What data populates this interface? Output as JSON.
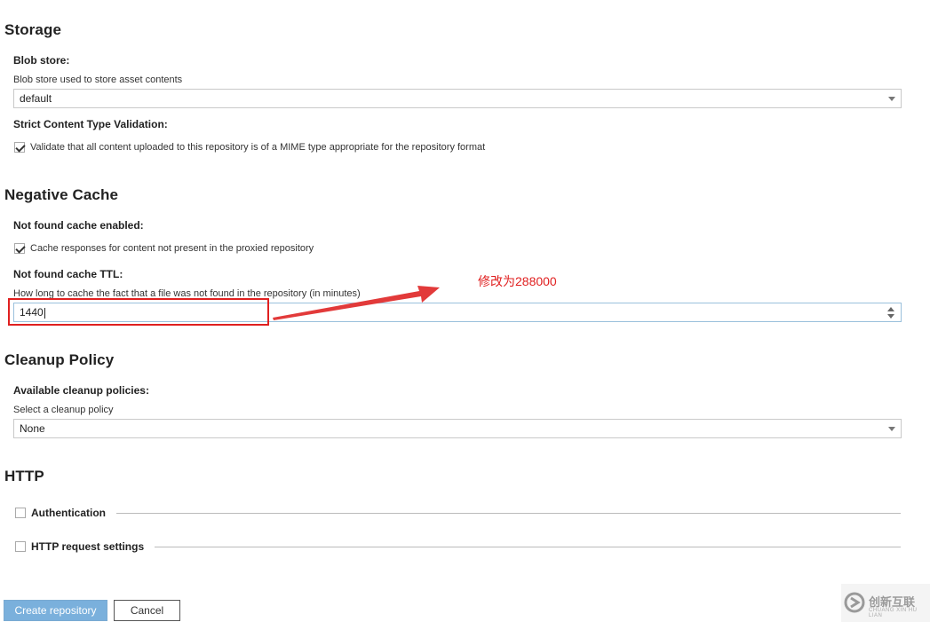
{
  "storage": {
    "title": "Storage",
    "blob_store": {
      "label": "Blob store:",
      "help": "Blob store used to store asset contents",
      "value": "default"
    },
    "strict_validation": {
      "label": "Strict Content Type Validation:",
      "checkbox_label": "Validate that all content uploaded to this repository is of a MIME type appropriate for the repository format",
      "checked": true
    }
  },
  "negative_cache": {
    "title": "Negative Cache",
    "enabled": {
      "label": "Not found cache enabled:",
      "checkbox_label": "Cache responses for content not present in the proxied repository",
      "checked": true
    },
    "ttl": {
      "label": "Not found cache TTL:",
      "help": "How long to cache the fact that a file was not found in the repository (in minutes)",
      "value": "1440"
    }
  },
  "annotation": {
    "text": "修改为288000",
    "color": "#e02020"
  },
  "cleanup_policy": {
    "title": "Cleanup Policy",
    "label": "Available cleanup policies:",
    "help": "Select a cleanup policy",
    "value": "None"
  },
  "http": {
    "title": "HTTP",
    "authentication": {
      "label": "Authentication",
      "checked": false
    },
    "request_settings": {
      "label": "HTTP request settings",
      "checked": false
    }
  },
  "actions": {
    "create_label": "Create repository",
    "cancel_label": "Cancel"
  },
  "watermark": {
    "text": "创新互联",
    "subtext": "CHUANG XIN HU LIAN"
  },
  "colors": {
    "primary_button": "#7ab0dc",
    "focus_border": "#9ac0dc",
    "annotation_red": "#e02020"
  }
}
